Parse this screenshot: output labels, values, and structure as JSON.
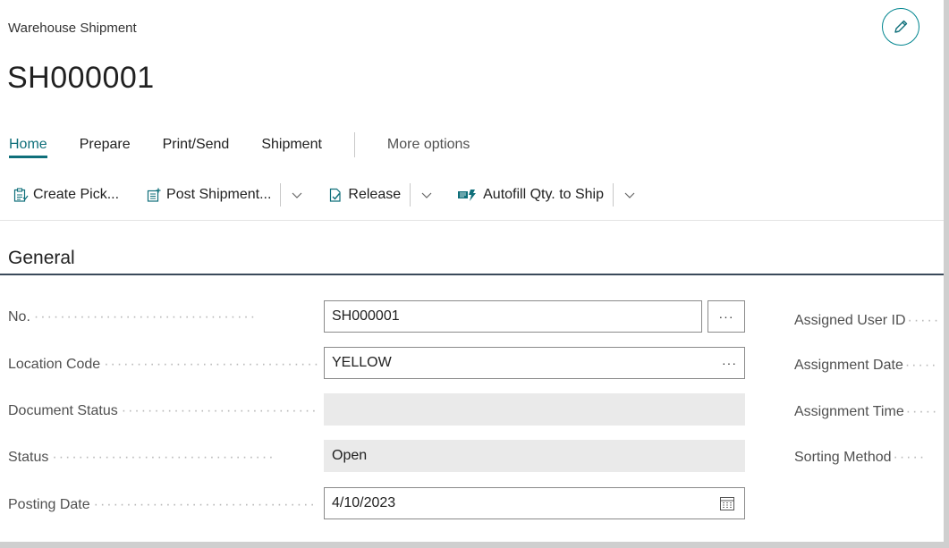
{
  "page": {
    "caption": "Warehouse Shipment",
    "record_no": "SH000001"
  },
  "icons": {
    "edit": "pencil-icon",
    "create_pick": "create-pick-icon",
    "post_shipment": "post-shipment-icon",
    "release": "release-icon",
    "autofill": "autofill-icon",
    "calendar": "calendar-icon"
  },
  "colors": {
    "accent": "#0f6f7a",
    "section_rule": "#3a4a5a",
    "readonly_bg": "#eaeaea"
  },
  "tabs": [
    {
      "label": "Home",
      "active": true
    },
    {
      "label": "Prepare",
      "active": false
    },
    {
      "label": "Print/Send",
      "active": false
    },
    {
      "label": "Shipment",
      "active": false
    }
  ],
  "more_options": "More options",
  "actions": {
    "create_pick": "Create Pick...",
    "post_shipment": "Post Shipment...",
    "release": "Release",
    "autofill": "Autofill Qty. to Ship"
  },
  "general": {
    "title": "General",
    "fields": {
      "no": {
        "label": "No.",
        "value": "SH000001"
      },
      "location_code": {
        "label": "Location Code",
        "value": "YELLOW"
      },
      "document_status": {
        "label": "Document Status",
        "value": ""
      },
      "status": {
        "label": "Status",
        "value": "Open"
      },
      "posting_date": {
        "label": "Posting Date",
        "value": "4/10/2023"
      }
    },
    "right_fields": {
      "assigned_user_id": "Assigned User ID",
      "assignment_date": "Assignment Date",
      "assignment_time": "Assignment Time",
      "sorting_method": "Sorting Method"
    },
    "assist_glyph": "···"
  }
}
